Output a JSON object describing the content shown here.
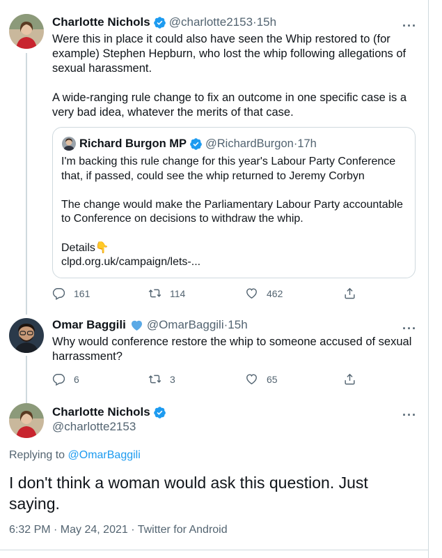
{
  "tweet1": {
    "name": "Charlotte Nichols",
    "handle": "@charlotte2153",
    "time": "15h",
    "text": "Were this in place it could also have seen the Whip restored to (for example) Stephen Hepburn, who lost the whip following allegations of sexual harassment.\n\nA wide-ranging rule change to fix an outcome in one specific case is a very bad idea, whatever the merits of that case.",
    "quote": {
      "name": "Richard Burgon MP",
      "handle": "@RichardBurgon",
      "time": "17h",
      "text": "I'm backing this rule change for this year's Labour Party Conference that, if passed, could see the whip returned to Jeremy Corbyn\n\nThe change would make the Parliamentary Labour Party accountable to Conference on decisions to withdraw the whip.\n\nDetails👇\nclpd.org.uk/campaign/lets-..."
    },
    "replies": "161",
    "retweets": "114",
    "likes": "462"
  },
  "tweet2": {
    "name": "Omar Baggili",
    "handle": "@OmarBaggili",
    "time": "15h",
    "text": "Why would conference restore the whip to someone accused of sexual harrassment?",
    "replies": "6",
    "retweets": "3",
    "likes": "65"
  },
  "main": {
    "name": "Charlotte Nichols",
    "handle": "@charlotte2153",
    "replying_prefix": "Replying to ",
    "replying_to": "@OmarBaggili",
    "text": "I don't think a woman would ask this question. Just saying.",
    "timestamp": "6:32 PM · May 24, 2021 · Twitter for Android"
  },
  "separator": " · ",
  "more_glyph": "···",
  "colors": {
    "accent": "#1d9bf0",
    "muted": "#536471",
    "border": "#cfd9de",
    "text": "#0f1419"
  },
  "icons": [
    "verified-badge-icon",
    "reply-icon",
    "retweet-icon",
    "like-icon",
    "share-icon",
    "more-icon",
    "blue-heart-icon"
  ]
}
